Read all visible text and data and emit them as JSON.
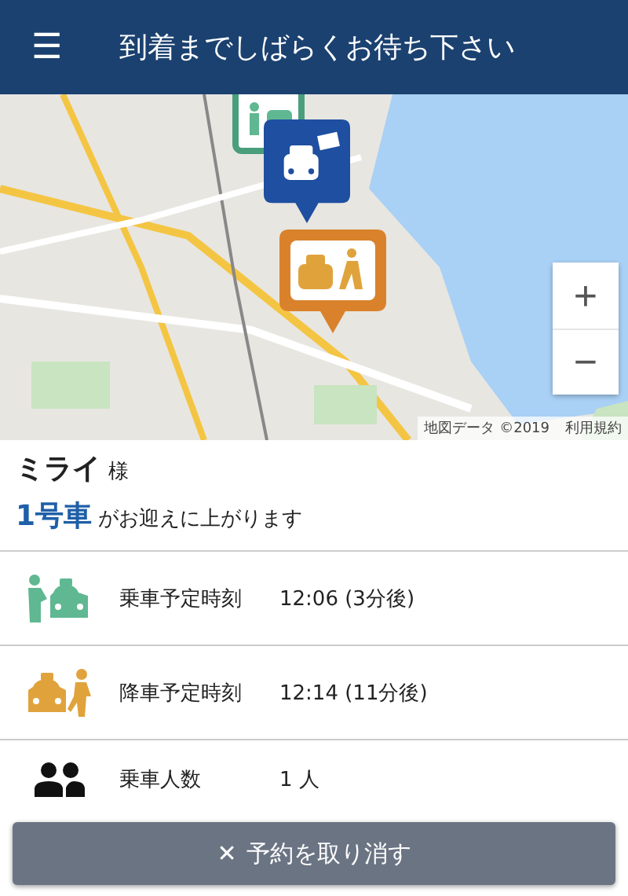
{
  "header": {
    "menu_icon": "☰",
    "title": "到着までしばらくお待ち下さい"
  },
  "map": {
    "kind": "picture",
    "zoom_in": "+",
    "zoom_out": "−",
    "attribution": "地図データ ©2019",
    "terms": "利用規約"
  },
  "customer": {
    "name": "ミライ",
    "honorific": "様"
  },
  "vehicle": {
    "number": "1号車",
    "message": "がお迎えに上がります"
  },
  "rows": [
    {
      "kind": "pickup",
      "label": "乗車予定時刻",
      "value": "12:06 (3分後)"
    },
    {
      "kind": "dropoff",
      "label": "降車予定時刻",
      "value": "12:14 (11分後)"
    },
    {
      "kind": "passengers",
      "label": "乗車人数",
      "value": "1 人"
    }
  ],
  "cancel_button": {
    "icon": "✕",
    "label": "予約を取り消す"
  }
}
